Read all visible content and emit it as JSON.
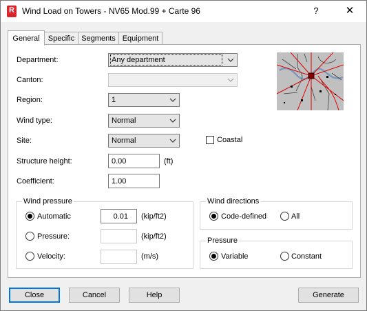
{
  "window": {
    "title": "Wind Load on Towers - NV65 Mod.99 + Carte 96",
    "app_icon_letter": "R",
    "help_glyph": "?",
    "close_glyph": "✕"
  },
  "tabs": [
    {
      "label": "General",
      "active": true
    },
    {
      "label": "Specific",
      "active": false
    },
    {
      "label": "Segments",
      "active": false
    },
    {
      "label": "Equipment",
      "active": false
    }
  ],
  "form": {
    "department_label": "Department:",
    "department_value": "Any department",
    "canton_label": "Canton:",
    "canton_value": "",
    "region_label": "Region:",
    "region_value": "1",
    "wind_type_label": "Wind type:",
    "wind_type_value": "Normal",
    "site_label": "Site:",
    "site_value": "Normal",
    "coastal_label": "Coastal",
    "coastal_checked": false,
    "structure_height_label": "Structure height:",
    "structure_height_value": "0.00",
    "structure_height_unit": "(ft)",
    "coefficient_label": "Coefficient:",
    "coefficient_value": "1.00"
  },
  "wind_pressure": {
    "title": "Wind pressure",
    "automatic_label": "Automatic",
    "automatic_value": "0.01",
    "automatic_unit": "(kip/ft2)",
    "pressure_label": "Pressure:",
    "pressure_value": "",
    "pressure_unit": "(kip/ft2)",
    "velocity_label": "Velocity:",
    "velocity_value": "",
    "velocity_unit": "(m/s)",
    "selected": "Automatic"
  },
  "wind_directions": {
    "title": "Wind directions",
    "code_defined_label": "Code-defined",
    "all_label": "All",
    "selected": "Code-defined"
  },
  "pressure": {
    "title": "Pressure",
    "variable_label": "Variable",
    "constant_label": "Constant",
    "selected": "Variable"
  },
  "buttons": {
    "close": "Close",
    "cancel": "Cancel",
    "help": "Help",
    "generate": "Generate"
  },
  "colors": {
    "map_background": "#c0c0c0",
    "map_roads": "#e00000",
    "map_river": "#7a9bbd",
    "default_button_border": "#0078d7"
  }
}
